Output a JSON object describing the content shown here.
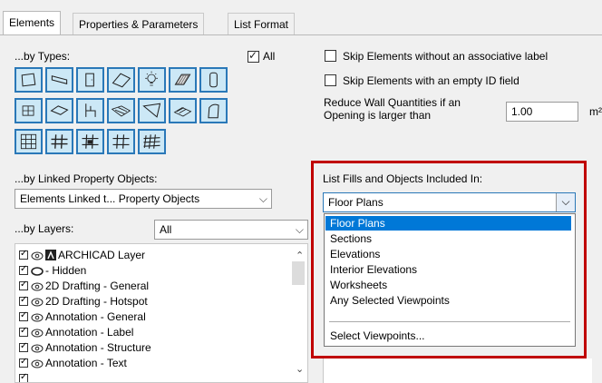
{
  "tabs": [
    "Elements",
    "Properties & Parameters",
    "List Format"
  ],
  "by_types": {
    "label": "...by Types:",
    "all_label": "All",
    "all_checked": true
  },
  "skip_label_text": "Skip Elements without an associative label",
  "skip_empty_id_text": "Skip Elements with an empty ID field",
  "reduce": {
    "line1": "Reduce Wall Quantities if an",
    "line2": "Opening is larger than",
    "value": "1.00",
    "unit": "m²"
  },
  "linked": {
    "label": "...by Linked Property Objects:",
    "value": "Elements Linked t... Property Objects"
  },
  "layers": {
    "label": "...by Layers:",
    "filter_value": "All",
    "items": [
      "ARCHICAD Layer",
      "- Hidden",
      "2D Drafting - General",
      "2D Drafting - Hotspot",
      "Annotation - General",
      "Annotation - Label",
      "Annotation - Structure",
      "Annotation - Text"
    ]
  },
  "fills": {
    "label": "List Fills and Objects Included In:",
    "value": "Floor Plans",
    "options": [
      "Floor Plans",
      "Sections",
      "Elevations",
      "Interior Elevations",
      "Worksheets",
      "Any Selected Viewpoints"
    ],
    "select_viewpoints": "Select Viewpoints...",
    "highlight_color": "#c00000"
  },
  "icons": {
    "type_buttons": [
      "slab-icon",
      "beam-icon",
      "door-icon",
      "roof-icon",
      "lamp-icon",
      "hatch-icon",
      "column-icon",
      "zone-icon",
      "wall-icon",
      "furniture-icon",
      "mesh-icon",
      "window-icon",
      "stair-icon",
      "shell-icon",
      "curtain-wall-icon",
      "railing-icon",
      "opening-icon",
      "panel-icon",
      "morph-icon"
    ]
  }
}
